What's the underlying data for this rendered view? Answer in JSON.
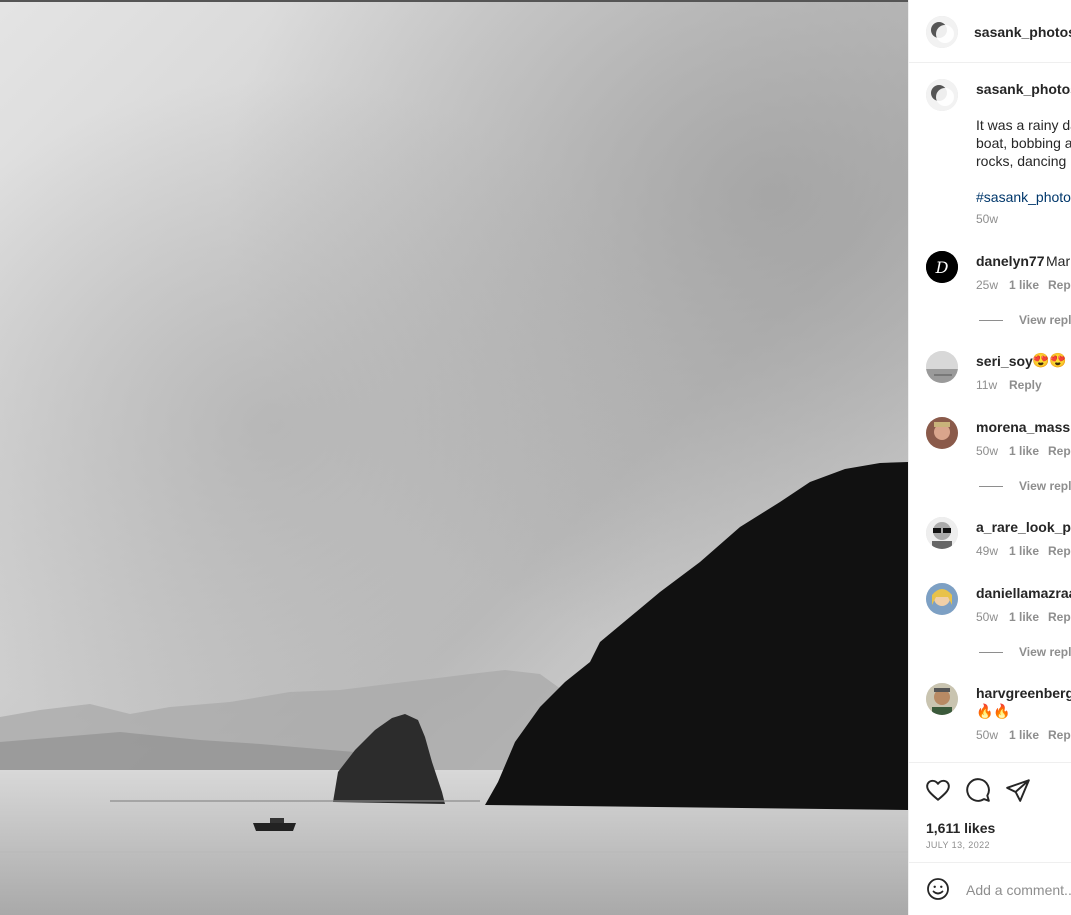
{
  "post": {
    "author": "sasank_photos",
    "caption_lines": [
      "It was a rainy da",
      "boat, bobbing a",
      "rocks, dancing i"
    ],
    "hashtag": "#sasank_photos",
    "age": "50w",
    "likes": "1,611 likes",
    "date": "JULY 13, 2022"
  },
  "comments": [
    {
      "user": "danelyn77",
      "text": "Mar",
      "age": "25w",
      "likes": "1 like",
      "reply": "Repl",
      "view_replies": "View repl"
    },
    {
      "user": "seri_soy",
      "text": "😍😍",
      "age": "11w",
      "likes": "",
      "reply": "Reply",
      "view_replies": ""
    },
    {
      "user": "morena_massin",
      "text": "",
      "age": "50w",
      "likes": "1 like",
      "reply": "Repl",
      "view_replies": "View repl"
    },
    {
      "user": "a_rare_look_ph",
      "text": "",
      "age": "49w",
      "likes": "1 like",
      "reply": "Repl",
      "view_replies": ""
    },
    {
      "user": "daniellamazraa",
      "text": "",
      "age": "50w",
      "likes": "1 like",
      "reply": "Repl",
      "view_replies": "View repl"
    },
    {
      "user": "harvgreenberg",
      "text": "🔥🔥",
      "age": "50w",
      "likes": "1 like",
      "reply": "Repl",
      "view_replies": ""
    }
  ],
  "composer": {
    "placeholder": "Add a comment..."
  },
  "icons": {
    "like": "heart-icon",
    "comment": "speech-bubble-icon",
    "share": "paper-plane-icon",
    "emoji": "smiley-icon"
  }
}
